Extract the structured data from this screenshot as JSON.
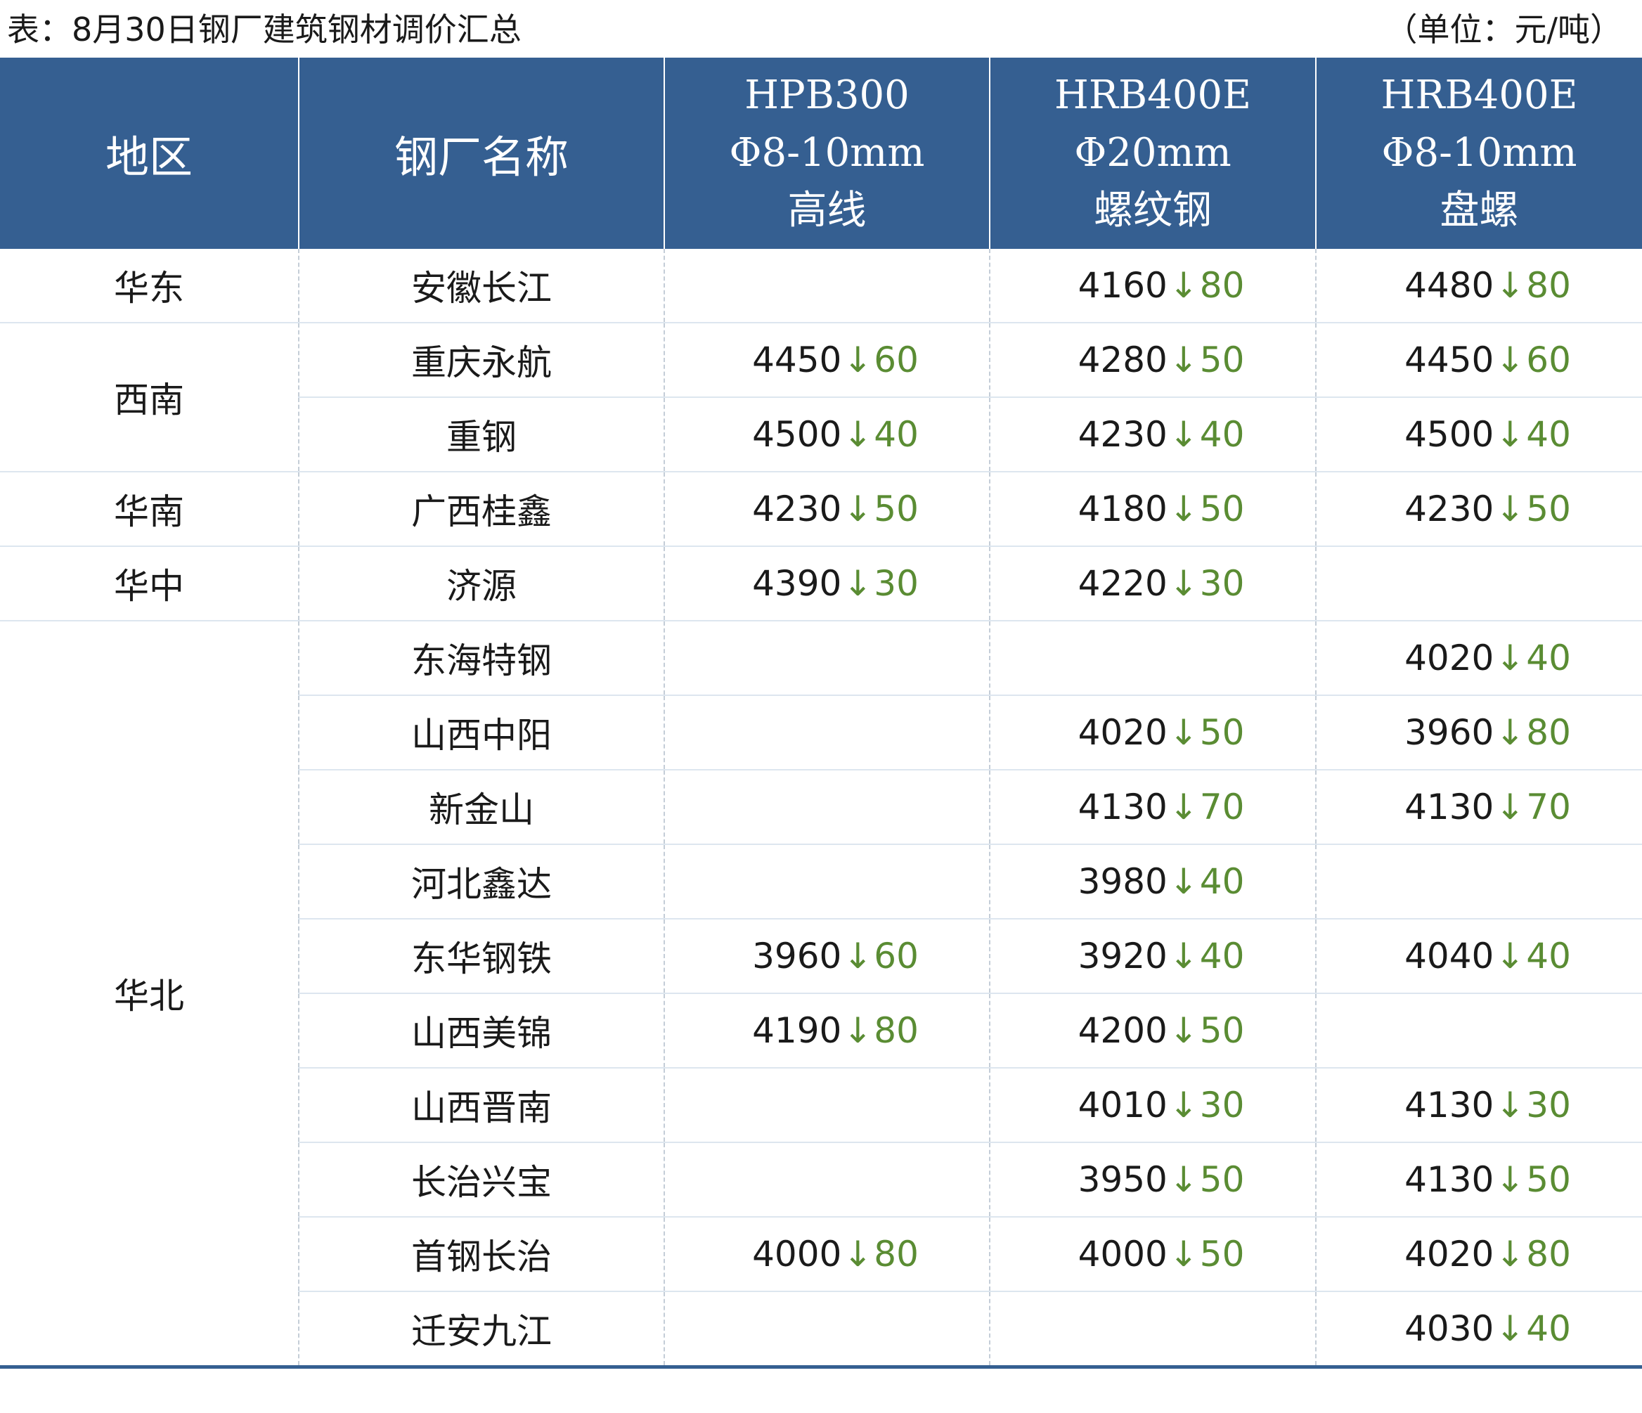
{
  "caption": {
    "title": "表：8月30日钢厂建筑钢材调价汇总",
    "unit": "（单位：元/吨）"
  },
  "header": {
    "region": "地区",
    "mill": "钢厂名称",
    "products": [
      {
        "grade": "HPB300",
        "size": "Φ8-10mm",
        "form": "高线"
      },
      {
        "grade": "HRB400E",
        "size": "Φ20mm",
        "form": "螺纹钢"
      },
      {
        "grade": "HRB400E",
        "size": "Φ8-10mm",
        "form": "盘螺"
      }
    ]
  },
  "change_glyph": "↓",
  "colors": {
    "header_bg": "#355f91",
    "change": "#5a8c33"
  },
  "rows": [
    {
      "region": "华东",
      "span": 1,
      "mill": "安徽长江",
      "cells": [
        null,
        {
          "price": "4160",
          "change": "80"
        },
        {
          "price": "4480",
          "change": "80"
        }
      ]
    },
    {
      "region": "西南",
      "span": 2,
      "mill": "重庆永航",
      "cells": [
        {
          "price": "4450",
          "change": "60"
        },
        {
          "price": "4280",
          "change": "50"
        },
        {
          "price": "4450",
          "change": "60"
        }
      ]
    },
    {
      "region": null,
      "mill": "重钢",
      "cells": [
        {
          "price": "4500",
          "change": "40"
        },
        {
          "price": "4230",
          "change": "40"
        },
        {
          "price": "4500",
          "change": "40"
        }
      ]
    },
    {
      "region": "华南",
      "span": 1,
      "mill": "广西桂鑫",
      "cells": [
        {
          "price": "4230",
          "change": "50"
        },
        {
          "price": "4180",
          "change": "50"
        },
        {
          "price": "4230",
          "change": "50"
        }
      ]
    },
    {
      "region": "华中",
      "span": 1,
      "mill": "济源",
      "cells": [
        {
          "price": "4390",
          "change": "30"
        },
        {
          "price": "4220",
          "change": "30"
        },
        null
      ]
    },
    {
      "region": "华北",
      "span": 10,
      "mill": "东海特钢",
      "cells": [
        null,
        null,
        {
          "price": "4020",
          "change": "40"
        }
      ]
    },
    {
      "region": null,
      "mill": "山西中阳",
      "cells": [
        null,
        {
          "price": "4020",
          "change": "50"
        },
        {
          "price": "3960",
          "change": "80"
        }
      ]
    },
    {
      "region": null,
      "mill": "新金山",
      "cells": [
        null,
        {
          "price": "4130",
          "change": "70"
        },
        {
          "price": "4130",
          "change": "70"
        }
      ]
    },
    {
      "region": null,
      "mill": "河北鑫达",
      "cells": [
        null,
        {
          "price": "3980",
          "change": "40"
        },
        null
      ]
    },
    {
      "region": null,
      "mill": "东华钢铁",
      "cells": [
        {
          "price": "3960",
          "change": "60"
        },
        {
          "price": "3920",
          "change": "40"
        },
        {
          "price": "4040",
          "change": "40"
        }
      ]
    },
    {
      "region": null,
      "mill": "山西美锦",
      "cells": [
        {
          "price": "4190",
          "change": "80"
        },
        {
          "price": "4200",
          "change": "50"
        },
        null
      ]
    },
    {
      "region": null,
      "mill": "山西晋南",
      "cells": [
        null,
        {
          "price": "4010",
          "change": "30"
        },
        {
          "price": "4130",
          "change": "30"
        }
      ]
    },
    {
      "region": null,
      "mill": "长治兴宝",
      "cells": [
        null,
        {
          "price": "3950",
          "change": "50"
        },
        {
          "price": "4130",
          "change": "50"
        }
      ]
    },
    {
      "region": null,
      "mill": "首钢长治",
      "cells": [
        {
          "price": "4000",
          "change": "80"
        },
        {
          "price": "4000",
          "change": "50"
        },
        {
          "price": "4020",
          "change": "80"
        }
      ]
    },
    {
      "region": null,
      "mill": "迁安九江",
      "cells": [
        null,
        null,
        {
          "price": "4030",
          "change": "40"
        }
      ]
    }
  ]
}
